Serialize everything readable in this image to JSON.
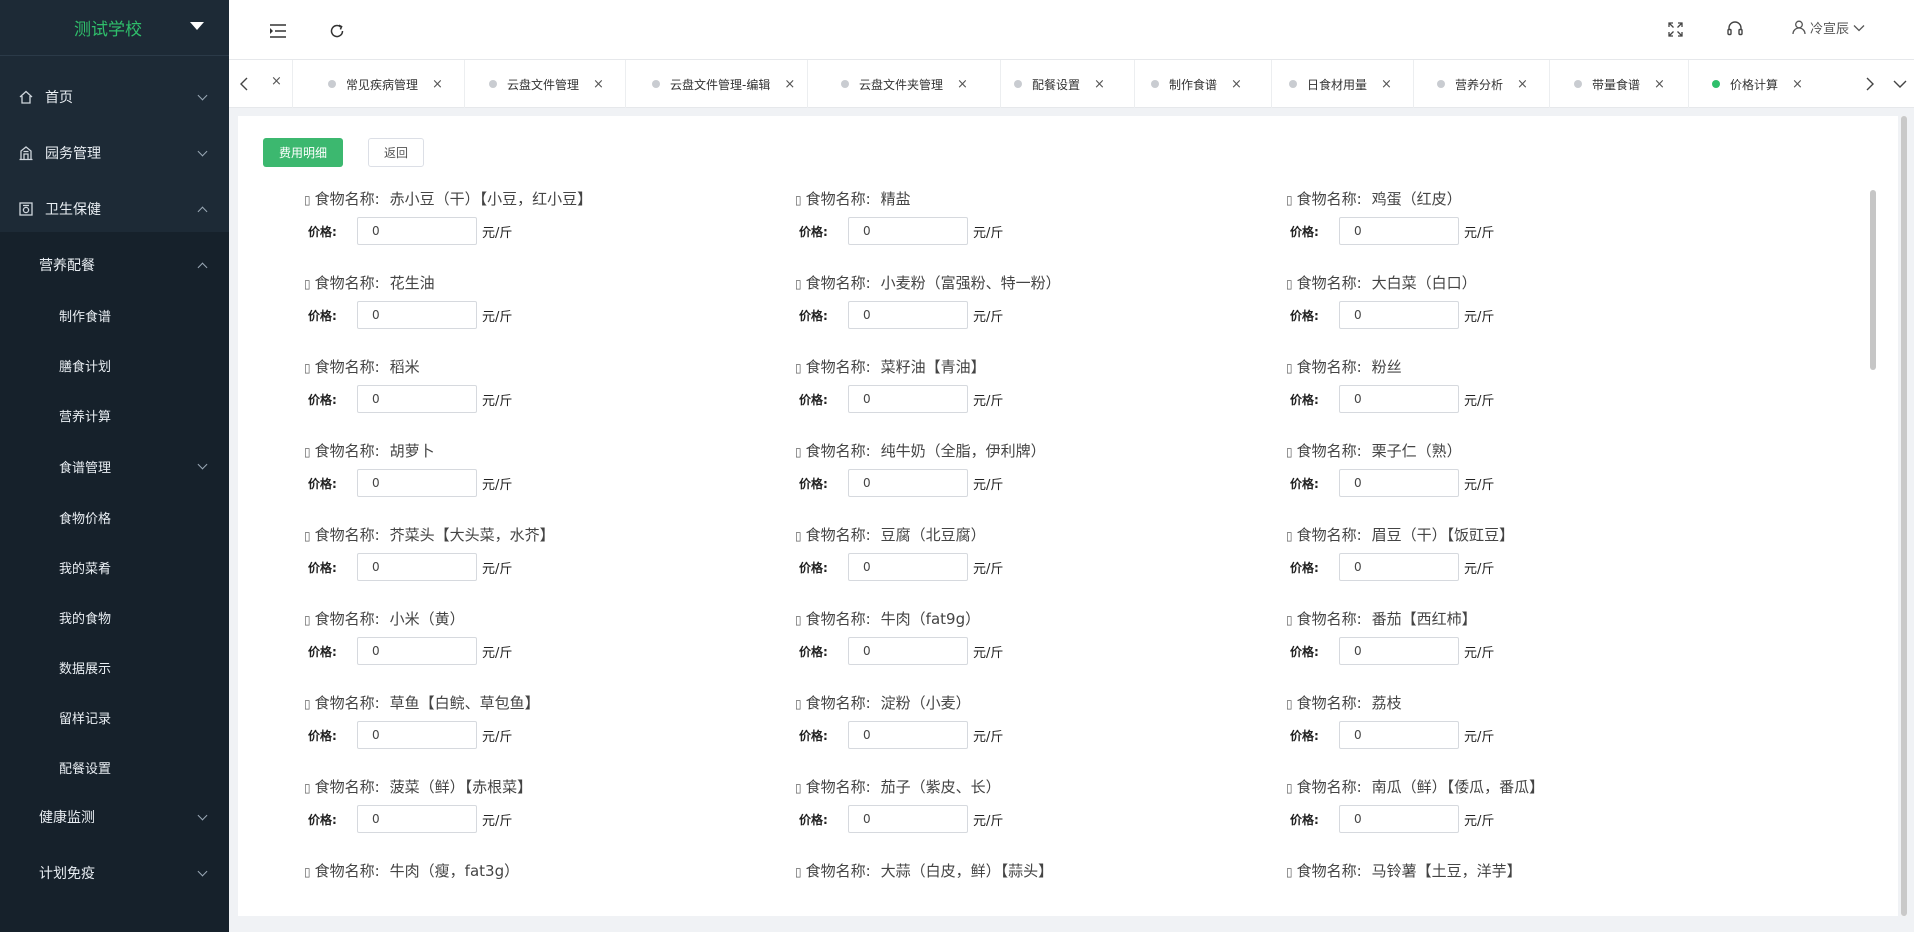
{
  "sidebar": {
    "school_name": "测试学校",
    "items": [
      {
        "label": "首页",
        "icon": "home-icon"
      },
      {
        "label": "园务管理",
        "icon": "building-icon"
      },
      {
        "label": "卫生保健",
        "icon": "health-icon"
      }
    ],
    "sub_group": {
      "label": "营养配餐"
    },
    "sub_items": [
      "制作食谱",
      "膳食计划",
      "营养计算",
      "食谱管理",
      "食物价格",
      "我的菜肴",
      "我的食物",
      "数据展示",
      "留样记录",
      "配餐设置"
    ],
    "bottom_items": [
      "健康监测",
      "计划免疫"
    ]
  },
  "header": {
    "user_name": "冷宣辰"
  },
  "tabs": [
    {
      "label": "常见疾病管理",
      "active": false
    },
    {
      "label": "云盘文件管理",
      "active": false
    },
    {
      "label": "云盘文件管理-编辑",
      "active": false
    },
    {
      "label": "云盘文件夹管理",
      "active": false
    },
    {
      "label": "配餐设置",
      "active": false
    },
    {
      "label": "制作食谱",
      "active": false
    },
    {
      "label": "日食材用量",
      "active": false
    },
    {
      "label": "营养分析",
      "active": false
    },
    {
      "label": "带量食谱",
      "active": false
    },
    {
      "label": "价格计算",
      "active": true
    }
  ],
  "toolbar": {
    "detail_button": "费用明细",
    "back_button": "返回"
  },
  "form": {
    "name_label": "食物名称:",
    "price_label": "价格:",
    "unit": "元/斤"
  },
  "foods": [
    {
      "name": "赤小豆（干）【小豆，红小豆】",
      "price": "0"
    },
    {
      "name": "精盐",
      "price": "0"
    },
    {
      "name": "鸡蛋（红皮）",
      "price": "0"
    },
    {
      "name": "花生油",
      "price": "0"
    },
    {
      "name": "小麦粉（富强粉、特一粉）",
      "price": "0"
    },
    {
      "name": "大白菜（白口）",
      "price": "0"
    },
    {
      "name": "稻米",
      "price": "0"
    },
    {
      "name": "菜籽油【青油】",
      "price": "0"
    },
    {
      "name": "粉丝",
      "price": "0"
    },
    {
      "name": "胡萝卜",
      "price": "0"
    },
    {
      "name": "纯牛奶（全脂，伊利牌）",
      "price": "0"
    },
    {
      "name": "栗子仁（熟）",
      "price": "0"
    },
    {
      "name": "芥菜头【大头菜，水芥】",
      "price": "0"
    },
    {
      "name": "豆腐（北豆腐）",
      "price": "0"
    },
    {
      "name": "眉豆（干）【饭豇豆】",
      "price": "0"
    },
    {
      "name": "小米（黄）",
      "price": "0"
    },
    {
      "name": "牛肉（fat9g）",
      "price": "0"
    },
    {
      "name": "番茄【西红柿】",
      "price": "0"
    },
    {
      "name": "草鱼【白鲩、草包鱼】",
      "price": "0"
    },
    {
      "name": "淀粉（小麦）",
      "price": "0"
    },
    {
      "name": "荔枝",
      "price": "0"
    },
    {
      "name": "菠菜（鲜）【赤根菜】",
      "price": "0"
    },
    {
      "name": "茄子（紫皮、长）",
      "price": "0"
    },
    {
      "name": "南瓜（鲜）【倭瓜，番瓜】",
      "price": "0"
    },
    {
      "name": "牛肉（瘦，fat3g）",
      "price": null
    },
    {
      "name": "大蒜（白皮，鲜）【蒜头】",
      "price": null
    },
    {
      "name": "马铃薯【土豆，洋芋】",
      "price": null
    }
  ]
}
